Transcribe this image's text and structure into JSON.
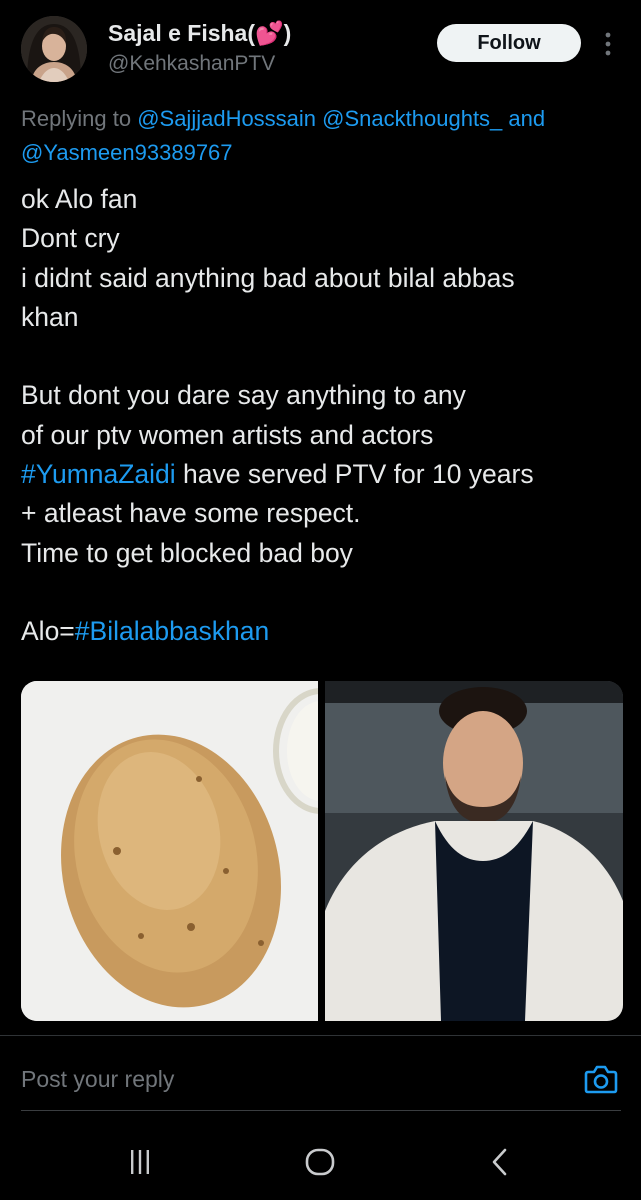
{
  "tweet": {
    "author_name": "Sajal e Fisha(💕)",
    "author_handle": "@KehkashanPTV",
    "follow_label": "Follow",
    "replying_prefix": "Replying to ",
    "replying_mentions": [
      "@SajjjadHosssain",
      "@Snackthoughts_",
      "@Yasmeen93389767"
    ],
    "replying_and": "and",
    "body_lines": [
      "ok Alo fan",
      "Dont cry",
      "i didnt said anything bad about bilal abbas",
      "khan",
      "",
      "But dont you dare say anything to any",
      "of our ptv women artists and actors"
    ],
    "hashtag_yumna": "#YumnaZaidi",
    "yumna_rest": " have served PTV for 10 years",
    "body_lines_after": [
      "+ atleast have some respect.",
      "Time to get blocked bad boy",
      ""
    ],
    "alo_prefix": "Alo=",
    "hashtag_bilal": "#Bilalabbaskhan"
  },
  "reply": {
    "placeholder": "Post your reply"
  },
  "icons": {
    "more": "more-vertical-icon",
    "camera": "camera-icon",
    "recents": "recent-apps-icon",
    "home": "home-icon",
    "back": "back-icon"
  },
  "colors": {
    "background": "#000000",
    "text": "#e7e9ea",
    "secondary": "#71767b",
    "accent": "#1d9bf0",
    "follow_bg": "#eff3f4"
  }
}
